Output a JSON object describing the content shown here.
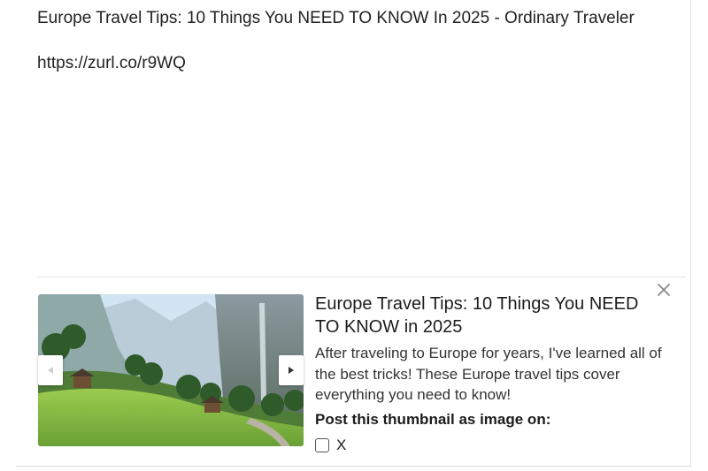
{
  "post": {
    "title_line": "Europe Travel Tips: 10 Things You NEED TO KNOW In 2025 - Ordinary Traveler",
    "short_url": "https://zurl.co/r9WQ"
  },
  "link_preview": {
    "title": "Europe Travel Tips: 10 Things You NEED TO KNOW in 2025",
    "description": "After traveling to Europe for years, I've learned all of the best tricks! These Europe travel tips cover everything you need to know!",
    "post_thumbnail_label": "Post this thumbnail as image on:",
    "options": [
      {
        "label": "X",
        "checked": false
      }
    ],
    "thumbnail_icon": "landscape-photo",
    "prev_icon": "triangle-left-icon",
    "next_icon": "triangle-right-icon",
    "close_icon": "close-icon"
  },
  "colors": {
    "text": "#222222",
    "divider": "#e2e2e2"
  }
}
